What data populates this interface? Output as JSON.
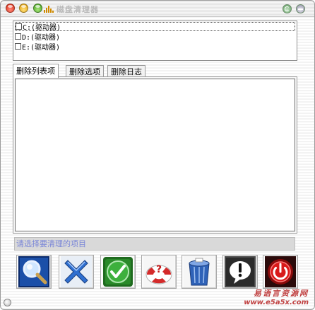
{
  "window": {
    "title": "磁盘清理器",
    "buttons": [
      "close-icon",
      "minimize-icon",
      "zoom-icon"
    ],
    "accent": "#d08a00"
  },
  "drives": [
    {
      "label": "C:(驱动器)",
      "checked": false,
      "focused": true
    },
    {
      "label": "D:(驱动器)",
      "checked": false,
      "focused": false
    },
    {
      "label": "E:(驱动器)",
      "checked": false,
      "focused": false
    }
  ],
  "tabs": [
    {
      "label": "删除列表项",
      "active": true
    },
    {
      "label": "删除选项",
      "active": false
    },
    {
      "label": "删除日志",
      "active": false
    }
  ],
  "status": {
    "text": "请选择要清理的项目",
    "color": "#7a86d8"
  },
  "toolbar": {
    "tools": [
      {
        "icon": "magnifier-icon"
      },
      {
        "icon": "delete-x-icon"
      },
      {
        "icon": "checkmark-icon"
      },
      {
        "icon": "lifebuoy-help-icon"
      },
      {
        "icon": "recycle-bin-icon"
      },
      {
        "icon": "info-exclamation-icon"
      },
      {
        "icon": "power-icon"
      }
    ]
  },
  "watermark": {
    "line1": "易语言资源网",
    "line2": "www.e5a5x.com"
  }
}
